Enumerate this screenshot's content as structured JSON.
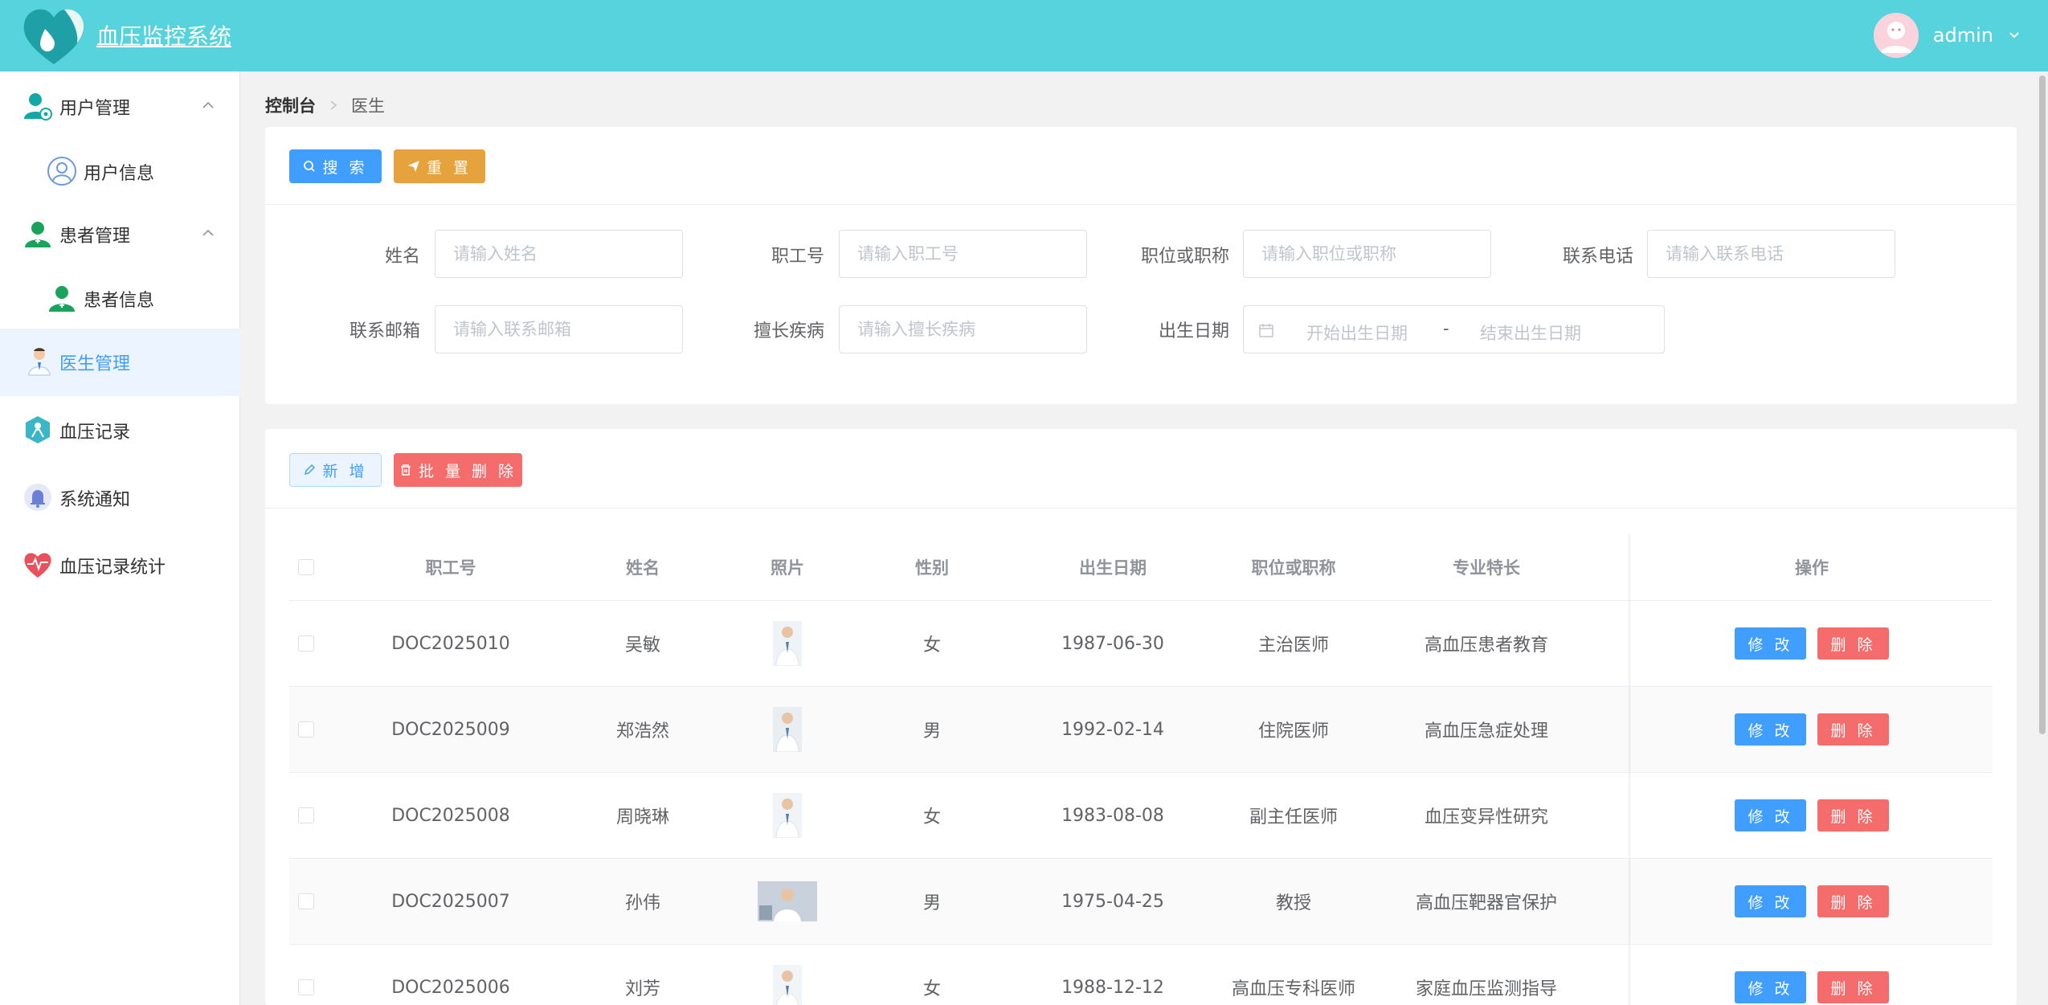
{
  "header": {
    "title": "血压监控系统",
    "user": "admin"
  },
  "sidebar": {
    "items": [
      {
        "label": "用户管理",
        "icon": "user-manage-icon"
      },
      {
        "label": "用户信息",
        "icon": "user-info-icon"
      },
      {
        "label": "患者管理",
        "icon": "patient-manage-icon"
      },
      {
        "label": "患者信息",
        "icon": "patient-info-icon"
      },
      {
        "label": "医生管理",
        "icon": "doctor-icon"
      },
      {
        "label": "血压记录",
        "icon": "bp-record-icon"
      },
      {
        "label": "系统通知",
        "icon": "bell-icon"
      },
      {
        "label": "血压记录统计",
        "icon": "heart-stats-icon"
      }
    ]
  },
  "breadcrumb": {
    "root": "控制台",
    "current": "医生"
  },
  "search": {
    "search_label": "搜 索",
    "reset_label": "重 置",
    "fields": [
      {
        "label": "姓名",
        "placeholder": "请输入姓名"
      },
      {
        "label": "职工号",
        "placeholder": "请输入职工号"
      },
      {
        "label": "职位或职称",
        "placeholder": "请输入职位或职称"
      },
      {
        "label": "联系电话",
        "placeholder": "请输入联系电话"
      },
      {
        "label": "联系邮箱",
        "placeholder": "请输入联系邮箱"
      },
      {
        "label": "擅长疾病",
        "placeholder": "请输入擅长疾病"
      }
    ],
    "date": {
      "label": "出生日期",
      "start": "开始出生日期",
      "sep": "-",
      "end": "结束出生日期"
    }
  },
  "toolbar": {
    "add_label": "新 增",
    "batch_delete_label": "批 量 删 除"
  },
  "table": {
    "columns": [
      "职工号",
      "姓名",
      "照片",
      "性别",
      "出生日期",
      "职位或职称",
      "专业特长",
      "操作"
    ],
    "edit_label": "修 改",
    "delete_label": "删 除",
    "rows": [
      {
        "id": "DOC2025010",
        "name": "吴敏",
        "gender": "女",
        "birth": "1987-06-30",
        "title": "主治医师",
        "specialty": "高血压患者教育"
      },
      {
        "id": "DOC2025009",
        "name": "郑浩然",
        "gender": "男",
        "birth": "1992-02-14",
        "title": "住院医师",
        "specialty": "高血压急症处理"
      },
      {
        "id": "DOC2025008",
        "name": "周晓琳",
        "gender": "女",
        "birth": "1983-08-08",
        "title": "副主任医师",
        "specialty": "血压变异性研究"
      },
      {
        "id": "DOC2025007",
        "name": "孙伟",
        "gender": "男",
        "birth": "1975-04-25",
        "title": "教授",
        "specialty": "高血压靶器官保护"
      },
      {
        "id": "DOC2025006",
        "name": "刘芳",
        "gender": "女",
        "birth": "1988-12-12",
        "title": "高血压专科医师",
        "specialty": "家庭血压监测指导"
      }
    ]
  }
}
